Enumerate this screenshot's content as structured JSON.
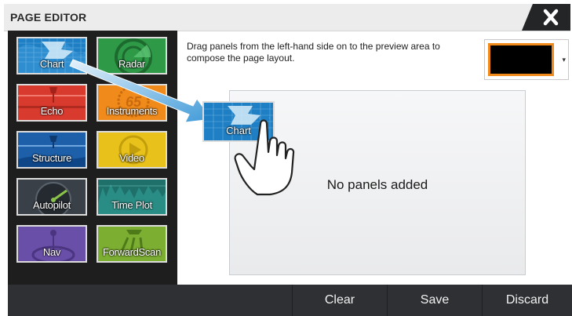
{
  "header": {
    "title": "PAGE EDITOR"
  },
  "panels": [
    {
      "label": "Chart",
      "icon": "chart-icon"
    },
    {
      "label": "Radar",
      "icon": "radar-icon"
    },
    {
      "label": "Echo",
      "icon": "echo-icon"
    },
    {
      "label": "Instruments",
      "icon": "instruments-icon"
    },
    {
      "label": "Structure",
      "icon": "structure-icon"
    },
    {
      "label": "Video",
      "icon": "video-icon"
    },
    {
      "label": "Autopilot",
      "icon": "autopilot-icon"
    },
    {
      "label": "Time Plot",
      "icon": "timeplot-icon"
    },
    {
      "label": "Nav",
      "icon": "nav-icon"
    },
    {
      "label": "ForwardScan",
      "icon": "forwardscan-icon"
    }
  ],
  "instructions": "Drag panels from the left-hand side on to the preview area to compose the page layout.",
  "color_select": {
    "selected_color": "#000000",
    "border_color": "#f08a1a"
  },
  "preview": {
    "empty_message": "No panels added"
  },
  "drag": {
    "tile_label": "Chart"
  },
  "instruments_readout": "65",
  "buttons": {
    "clear": "Clear",
    "save": "Save",
    "discard": "Discard"
  },
  "colors": {
    "chart": "#1f7fc4",
    "radar": "#2e9a48",
    "echo": "#d93a2e",
    "instruments": "#f08a1a",
    "structure": "#1d5fa8",
    "video": "#e8c21a",
    "autopilot": "#3a4048",
    "timeplot": "#1f6f6a",
    "nav": "#6a4fa8",
    "forwardscan": "#7cae32"
  }
}
